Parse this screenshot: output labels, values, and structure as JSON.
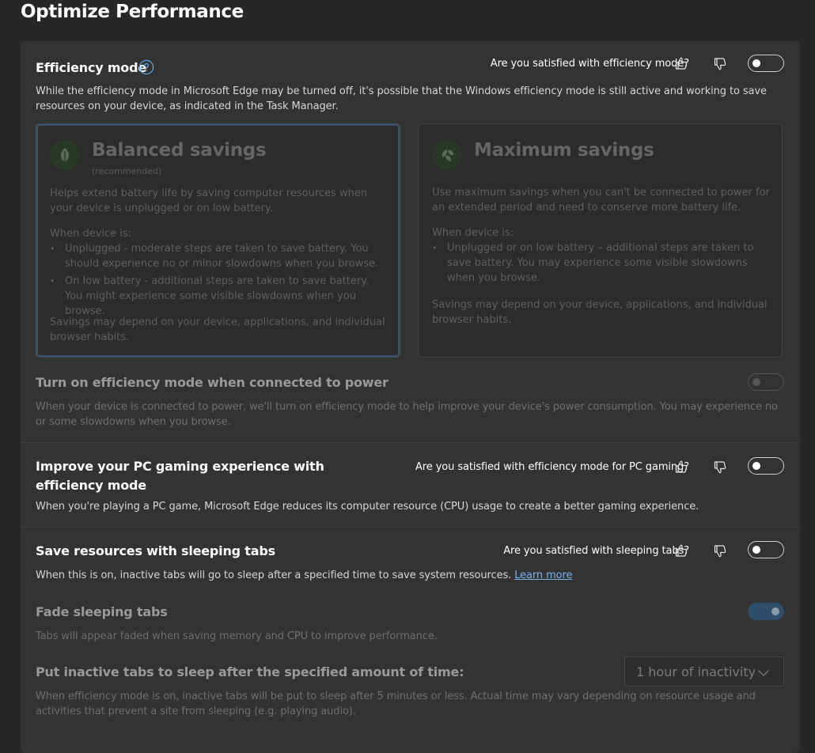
{
  "page": {
    "title": "Optimize Performance"
  },
  "efficiency_mode": {
    "title": "Efficiency mode",
    "help_icon": "question-circle-icon",
    "feedback_prompt": "Are you satisfied with efficiency mode?",
    "toggle_on": false,
    "description": "While the efficiency mode in Microsoft Edge may be turned off, it's possible that the Windows efficiency mode is still active and working to save resources on your device, as indicated in the Task Manager.",
    "options": [
      {
        "name": "Balanced savings",
        "tag": "(recommended)",
        "icon": "leaf-icon",
        "selected": true,
        "summary": "Helps extend battery life by saving computer resources when your device is unplugged or on low battery.",
        "when_label": "When device is:",
        "bullets": [
          "Unplugged - moderate steps are taken to save battery. You should experience no or minor slowdowns when you browse.",
          "On low battery - additional steps are taken to save battery. You might experience some visible slowdowns when you browse."
        ],
        "footer": "Savings may depend on your device, applications, and individual browser habits."
      },
      {
        "name": "Maximum savings",
        "tag": "",
        "icon": "leaves-icon",
        "selected": false,
        "summary": "Use maximum savings when you can't be connected to power for an extended period and need to conserve more battery life.",
        "when_label": "When device is:",
        "bullets": [
          "Unplugged or on low battery – additional steps are taken to save battery. You may experience some visible slowdowns when you browse."
        ],
        "footer": "Savings may depend on your device, applications, and individual browser habits."
      }
    ]
  },
  "connected_power": {
    "title": "Turn on efficiency mode when connected to power",
    "description": "When your device is connected to power, we'll turn on efficiency mode to help improve your device's power consumption. You may experience no or some slowdowns when you browse.",
    "toggle_on": false,
    "disabled": true
  },
  "gaming": {
    "title": "Improve your PC gaming experience with efficiency mode",
    "feedback_prompt": "Are you satisfied with efficiency mode for PC gaming?",
    "description": "When you're playing a PC game, Microsoft Edge reduces its computer resource (CPU) usage to create a better gaming experience.",
    "toggle_on": false
  },
  "sleeping_tabs": {
    "title": "Save resources with sleeping tabs",
    "feedback_prompt": "Are you satisfied with sleeping tabs?",
    "description": "When this is on, inactive tabs will go to sleep after a specified time to save system resources.",
    "learn_more": "Learn more",
    "toggle_on": false
  },
  "fade_tabs": {
    "title": "Fade sleeping tabs",
    "description": "Tabs will appear faded when saving memory and CPU to improve performance.",
    "toggle_on": true,
    "disabled": true
  },
  "sleep_timer": {
    "title": "Put inactive tabs to sleep after the specified amount of time:",
    "description": "When efficiency mode is on, inactive tabs will be put to sleep after 5 minutes or less. Actual time may vary depending on resource usage and activities that prevent a site from sleeping (e.g. playing audio).",
    "selected_value": "1 hour of inactivity"
  },
  "icons": {
    "like": "thumbs-up-icon",
    "dislike": "thumbs-down-icon",
    "dropdown": "chevron-down-icon"
  },
  "colors": {
    "background": "#272727",
    "card": "#333333",
    "link": "#79b2ea",
    "selected_border": "#3c5067",
    "toggle_on_dim": "#2e4e6a"
  }
}
